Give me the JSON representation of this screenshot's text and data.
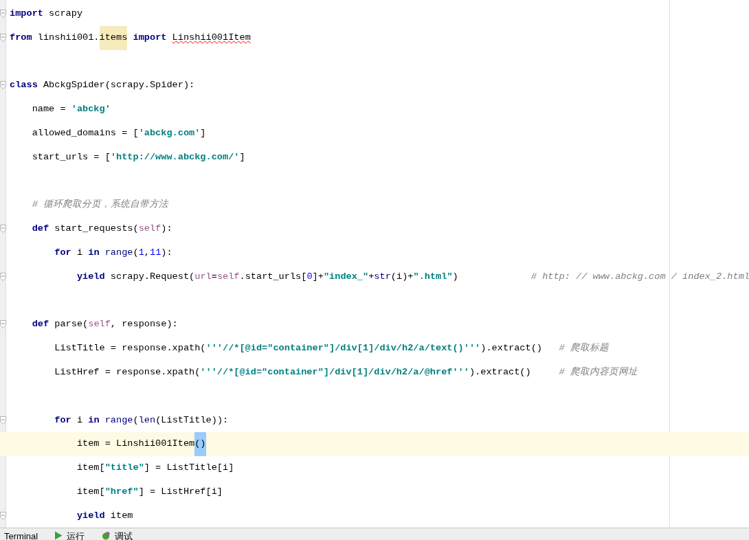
{
  "editor": {
    "lines": [
      {
        "fold": true,
        "current": false,
        "tokens": [
          {
            "kind": "keyword",
            "t": "import"
          },
          {
            "kind": "plain",
            "t": " scrapy"
          }
        ]
      },
      {
        "fold": true,
        "current": false,
        "tokens": [
          {
            "kind": "keyword",
            "t": "from"
          },
          {
            "kind": "plain",
            "t": " linshii001."
          },
          {
            "kind": "usage",
            "t": "items"
          },
          {
            "kind": "keyword",
            "t": " import "
          },
          {
            "kind": "error",
            "t": "Linshii001Item"
          }
        ]
      },
      {
        "fold": false,
        "current": false
      },
      {
        "fold": true,
        "current": false,
        "tokens": [
          {
            "kind": "keyword",
            "t": "class"
          },
          {
            "kind": "plain",
            "t": " AbckgSpider(scrapy.Spider):"
          }
        ]
      },
      {
        "fold": false,
        "current": false,
        "tokens": [
          {
            "kind": "plain",
            "t": "    name = "
          },
          {
            "kind": "string",
            "t": "'abckg'"
          }
        ]
      },
      {
        "fold": false,
        "current": false,
        "tokens": [
          {
            "kind": "plain",
            "t": "    allowed_domains = ["
          },
          {
            "kind": "string",
            "t": "'abckg.com'"
          },
          {
            "kind": "plain",
            "t": "]"
          }
        ]
      },
      {
        "fold": false,
        "current": false,
        "tokens": [
          {
            "kind": "plain",
            "t": "    start_urls = ["
          },
          {
            "kind": "string",
            "t": "'http://www.abckg.com/'"
          },
          {
            "kind": "plain",
            "t": "]"
          }
        ]
      },
      {
        "fold": false,
        "current": false
      },
      {
        "fold": false,
        "current": false,
        "tokens": [
          {
            "kind": "comment",
            "t": "    # 循环爬取分页，系统自带方法"
          }
        ]
      },
      {
        "fold": true,
        "current": false,
        "tokens": [
          {
            "kind": "keyword",
            "t": "    def"
          },
          {
            "kind": "plain",
            "t": " start_requests("
          },
          {
            "kind": "self",
            "t": "self"
          },
          {
            "kind": "plain",
            "t": "):"
          }
        ]
      },
      {
        "fold": false,
        "current": false,
        "tokens": [
          {
            "kind": "keyword",
            "t": "        for"
          },
          {
            "kind": "plain",
            "t": " i "
          },
          {
            "kind": "keyword",
            "t": "in"
          },
          {
            "kind": "builtin",
            "t": " range"
          },
          {
            "kind": "plain",
            "t": "("
          },
          {
            "kind": "number",
            "t": "1"
          },
          {
            "kind": "plain",
            "t": ","
          },
          {
            "kind": "number",
            "t": "11"
          },
          {
            "kind": "plain",
            "t": "):"
          }
        ]
      },
      {
        "fold": true,
        "current": false,
        "tokens": [
          {
            "kind": "keyword",
            "t": "            yield"
          },
          {
            "kind": "plain",
            "t": " scrapy.Request("
          },
          {
            "kind": "self",
            "t": "url"
          },
          {
            "kind": "plain",
            "t": "="
          },
          {
            "kind": "self",
            "t": "self"
          },
          {
            "kind": "plain",
            "t": ".start_urls["
          },
          {
            "kind": "number",
            "t": "0"
          },
          {
            "kind": "plain",
            "t": "]+"
          },
          {
            "kind": "string",
            "t": "\"index_\""
          },
          {
            "kind": "plain",
            "t": "+"
          },
          {
            "kind": "builtin",
            "t": "str"
          },
          {
            "kind": "plain",
            "t": "(i)+"
          },
          {
            "kind": "string",
            "t": "\".html\""
          },
          {
            "kind": "plain",
            "t": ")"
          },
          {
            "kind": "comment",
            "t": "             # http: // www.abckg.com / index_2.html"
          }
        ]
      },
      {
        "fold": false,
        "current": false
      },
      {
        "fold": true,
        "current": false,
        "tokens": [
          {
            "kind": "keyword",
            "t": "    def"
          },
          {
            "kind": "plain",
            "t": " parse("
          },
          {
            "kind": "self",
            "t": "self"
          },
          {
            "kind": "plain",
            "t": ", response):"
          }
        ]
      },
      {
        "fold": false,
        "current": false,
        "tokens": [
          {
            "kind": "plain",
            "t": "        ListTitle = response.xpath("
          },
          {
            "kind": "string",
            "t": "'''//*[@id=\"container\"]/div[1]/div/h2/a/text()'''"
          },
          {
            "kind": "plain",
            "t": ").extract()"
          },
          {
            "kind": "comment",
            "t": "   # 爬取标题"
          }
        ]
      },
      {
        "fold": false,
        "current": false,
        "tokens": [
          {
            "kind": "plain",
            "t": "        ListHref = response.xpath("
          },
          {
            "kind": "string",
            "t": "'''//*[@id=\"container\"]/div[1]/div/h2/a/@href'''"
          },
          {
            "kind": "plain",
            "t": ").extract()"
          },
          {
            "kind": "comment",
            "t": "     # 爬取内容页网址"
          }
        ]
      },
      {
        "fold": false,
        "current": false
      },
      {
        "fold": true,
        "current": false,
        "tokens": [
          {
            "kind": "keyword",
            "t": "        for"
          },
          {
            "kind": "plain",
            "t": " i "
          },
          {
            "kind": "keyword",
            "t": "in"
          },
          {
            "kind": "builtin",
            "t": " range"
          },
          {
            "kind": "plain",
            "t": "("
          },
          {
            "kind": "builtin",
            "t": "len"
          },
          {
            "kind": "plain",
            "t": "(ListTitle)):"
          }
        ]
      },
      {
        "fold": false,
        "current": true,
        "tokens": [
          {
            "kind": "plain",
            "t": "            item = Linshii001Item"
          },
          {
            "kind": "brace",
            "t": "()"
          }
        ]
      },
      {
        "fold": false,
        "current": false,
        "tokens": [
          {
            "kind": "plain",
            "t": "            item["
          },
          {
            "kind": "string",
            "t": "\"title\""
          },
          {
            "kind": "plain",
            "t": "] = ListTitle[i]"
          }
        ]
      },
      {
        "fold": false,
        "current": false,
        "tokens": [
          {
            "kind": "plain",
            "t": "            item["
          },
          {
            "kind": "string",
            "t": "\"href\""
          },
          {
            "kind": "plain",
            "t": "] = ListHref[i]"
          }
        ]
      },
      {
        "fold": true,
        "current": false,
        "tokens": [
          {
            "kind": "keyword",
            "t": "            yield"
          },
          {
            "kind": "plain",
            "t": " item"
          }
        ]
      }
    ]
  },
  "bottom_bar": {
    "tabs": [
      {
        "kind": "terminal",
        "label": "Terminal"
      },
      {
        "kind": "run",
        "label": "运行"
      },
      {
        "kind": "debug",
        "label": "调试"
      }
    ]
  }
}
